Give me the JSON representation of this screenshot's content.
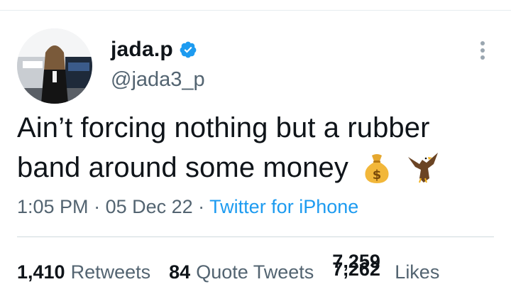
{
  "tweet": {
    "author": {
      "display_name": "jada.p",
      "handle": "@jada3_p",
      "verified": true
    },
    "text_line1": "Ain’t forcing nothing but a rubber",
    "text_line2": "band around some money",
    "emojis": [
      "money-bag-icon",
      "eagle-icon"
    ],
    "meta": {
      "time": "1:05 PM",
      "separator": " · ",
      "date": "05 Dec 22",
      "source": "Twitter for iPhone"
    },
    "stats": {
      "retweets_count": "1,410",
      "retweets_label": "Retweets",
      "quotes_count": "84",
      "quotes_label": "Quote Tweets",
      "likes_count_old": "7,259",
      "likes_count_new": "7,262",
      "likes_label": "Likes"
    }
  },
  "colors": {
    "text_primary": "#0f1419",
    "text_secondary": "#536471",
    "link": "#1d9bf0",
    "verified": "#1d9bf0"
  }
}
